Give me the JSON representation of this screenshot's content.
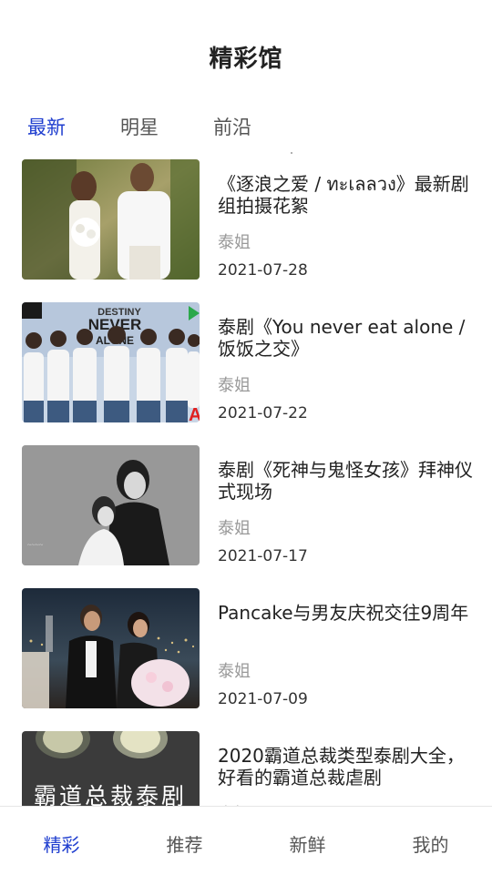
{
  "header": {
    "title": "精彩馆"
  },
  "tabs": [
    {
      "label": "最新",
      "active": true
    },
    {
      "label": "明星",
      "active": false
    },
    {
      "label": "前沿",
      "active": false
    }
  ],
  "articles": [
    {
      "title": "《逐浪之爱 / ทะเลลวง》最新剧组拍摄花絮",
      "source": "泰姐",
      "date": "2021-07-28"
    },
    {
      "title": "泰剧《You never eat alone / 饭饭之交》",
      "source": "泰姐",
      "date": "2021-07-22",
      "image_text": {
        "line1": "DESTINY",
        "line2": "NEVER",
        "line3": "ALONE",
        "badge": "A"
      }
    },
    {
      "title": "泰剧《死神与鬼怪女孩》拜神仪式现场",
      "source": "泰姐",
      "date": "2021-07-17"
    },
    {
      "title": "Pancake与男友庆祝交往9周年",
      "source": "泰姐",
      "date": "2021-07-09"
    },
    {
      "title": "2020霸道总裁类型泰剧大全，好看的霸道总裁虐剧",
      "source": "泰姐",
      "date": "",
      "image_text": "霸道总裁泰剧"
    }
  ],
  "bottom_nav": [
    {
      "label": "精彩",
      "active": true
    },
    {
      "label": "推荐",
      "active": false
    },
    {
      "label": "新鲜",
      "active": false
    },
    {
      "label": "我的",
      "active": false
    }
  ],
  "colors": {
    "accent": "#1f3ecf",
    "text": "#222222",
    "muted": "#999999"
  }
}
